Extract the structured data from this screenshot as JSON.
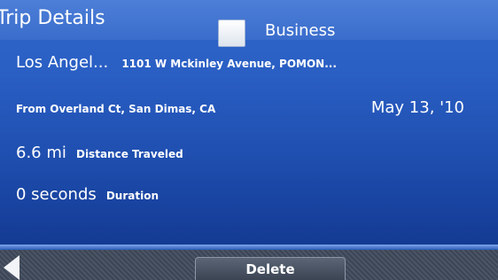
{
  "header": {
    "title": "Trip Details",
    "business_checkbox_checked": false,
    "business_label": "Business"
  },
  "trip": {
    "destination_name": "Los Angel...",
    "destination_address": "1101 W Mckinley Avenue, POMON...",
    "origin": "From Overland Ct, San Dimas, CA",
    "date": "May 13, '10",
    "distance_value": "6.6 mi",
    "distance_label": "Distance Traveled",
    "duration_value": "0 seconds",
    "duration_label": "Duration"
  },
  "footer": {
    "back_icon": "back-arrow-icon",
    "delete_label": "Delete"
  },
  "colors": {
    "background": "#2a5fc4",
    "header": "#3a6dcc",
    "footer": "#3c4555"
  }
}
